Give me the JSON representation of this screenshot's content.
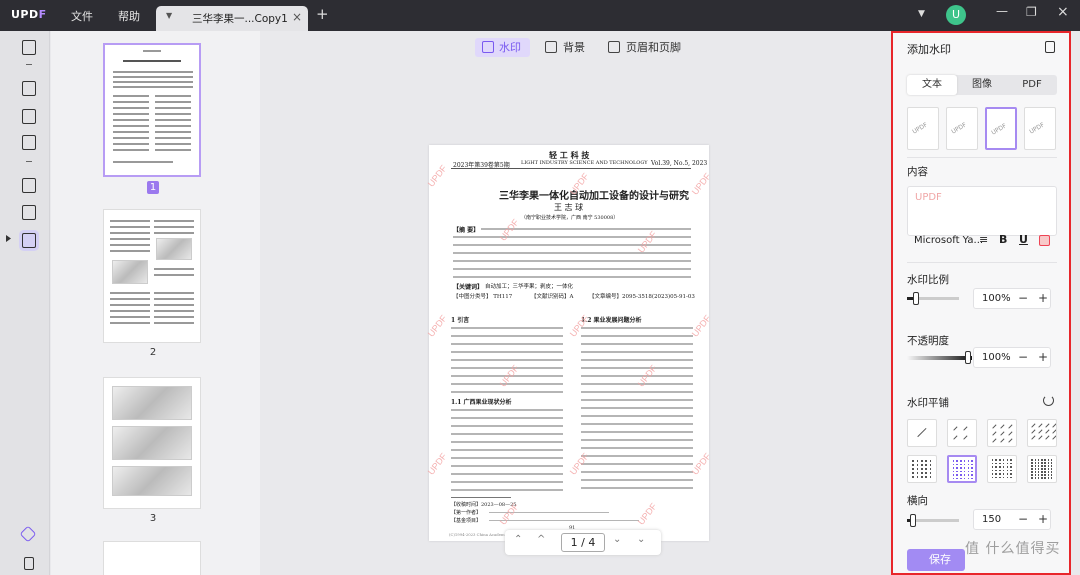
{
  "app": {
    "logo_main": "UPD",
    "logo_accent": "F",
    "menu": [
      "文件",
      "帮助"
    ],
    "tab_title": "三华李果一...Copy1",
    "avatar": "U"
  },
  "thumbs": {
    "selected": "1",
    "page2": "2",
    "page3": "3"
  },
  "toolbar": {
    "watermark": "水印",
    "background": "背景",
    "header_footer": "页眉和页脚"
  },
  "document": {
    "journal": "轻 工 科 技",
    "issue": "2023年第39卷第5期",
    "journal_en": "LIGHT INDUSTRY SCIENCE AND TECHNOLOGY",
    "volume": "Vol.39, No.5, 2023",
    "title": "三华李果一体化自动加工设备的设计与研究",
    "author": "王 志 球",
    "affil": "（南宁职业技术学院，广西 南宁 530008）",
    "abstract_label": "【摘 要】",
    "keywords_label": "【关键词】",
    "keywords": "自动加工；三华李果；剥皮；一体化",
    "clc": "【中图分类号】 TH117",
    "doccode": "【文献识别码】A",
    "article_no": "【文章编号】2095-3518(2023)05-91-03",
    "sec1": "1 引言",
    "sec11": "1.1 广西果业现状分析",
    "sec12": "1.2 果业发展问题分析",
    "received": "【收稿时间】2023—08—25",
    "first_author": "【第一作者】",
    "fund": "【基金项目】",
    "page_no": "91",
    "copyright": "(C)1994-2023 China Academic Journal Electronic Publishing House. All rights reserved.   http://www.cnki.net",
    "wm": "UPDF"
  },
  "pagenav": {
    "current": "1",
    "sep": "/",
    "total": "4"
  },
  "panel": {
    "title": "添加水印",
    "tabs": [
      "文本",
      "图像",
      "PDF"
    ],
    "content_label": "内容",
    "content_placeholder": "UPDF",
    "font": "Microsoft Ya...",
    "scale_label": "水印比例",
    "scale": "100%",
    "opacity_label": "不透明度",
    "opacity": "100%",
    "tile_label": "水印平铺",
    "horizontal_label": "横向",
    "horizontal": "150",
    "save": "保存",
    "scale_fraction": 0.18,
    "opacity_fraction": 1.0,
    "horizontal_fraction": 0.12
  },
  "colors": {
    "accent": "#9b79ee",
    "highlight_border": "#e8262b",
    "watermark": "#f3a3a3"
  },
  "overlay": "值 什么值得买"
}
